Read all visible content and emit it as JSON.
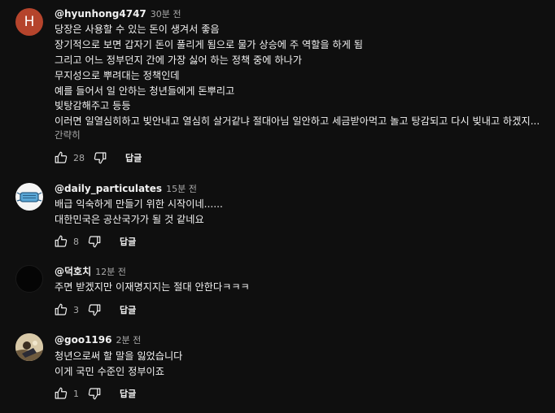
{
  "reply_label": "답글",
  "more_label": "간략히",
  "comments": [
    {
      "author": "@hyunhong4747",
      "time": "30분 전",
      "avatar_letter": "H",
      "lines": [
        "당장은 사용할 수 있는 돈이 생겨서 좋음",
        "장기적으로 보면 갑자기 돈이 풀리게 됨으로 물가 상승에 주 역할을 하게 됨",
        "그리고 어느 정부던지 간에 가장 싫어 하는 정책 중에 하나가",
        "무지성으로 뿌려대는 정책인데",
        "예를 들어서 일 안하는 청년들에게 돈뿌리고",
        "빚탕감해주고 등등",
        "이러면 일열심히하고 빚안내고 열심히 살거같냐 절대아님 일안하고 세금받아먹고 놀고 탕감되고 다시 빚내고 하겠지..."
      ],
      "likes": "28"
    },
    {
      "author": "@daily_particulates",
      "time": "15분 전",
      "lines": [
        "배급 익숙하게 만들기 위한 시작이네......",
        "대한민국은 공산국가가 될 것 같네요"
      ],
      "likes": "8"
    },
    {
      "author": "@덕호치",
      "time": "12분 전",
      "lines": [
        "주면 받겠지만 이재명지지는 절대 안한다ㅋㅋㅋ"
      ],
      "likes": "3"
    },
    {
      "author": "@goo1196",
      "time": "2분 전",
      "lines": [
        "청년으로써 할 말을 잃었습니다",
        "이게 국민 수준인 정부이죠"
      ],
      "likes": "1"
    }
  ]
}
